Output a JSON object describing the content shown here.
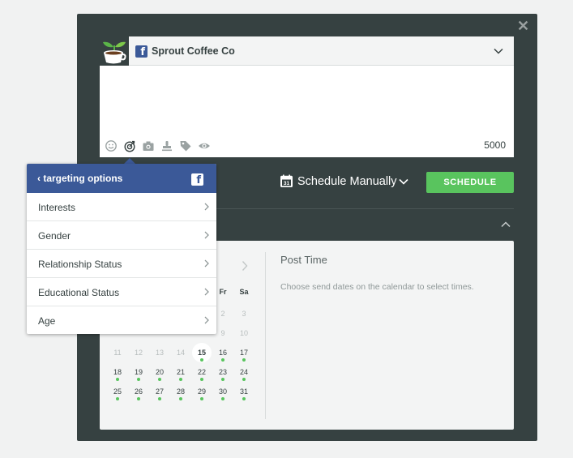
{
  "composer": {
    "profile_name": "Sprout Coffee Co",
    "char_count": "5000",
    "tools": [
      "emoji-icon",
      "target-icon",
      "camera-icon",
      "stamp-icon",
      "tag-icon",
      "preview-eye-icon"
    ]
  },
  "schedule": {
    "mode": "Schedule Manually",
    "button": "SCHEDULE"
  },
  "targeting": {
    "back_label": "‹ targeting options",
    "items": [
      {
        "label": "Interests"
      },
      {
        "label": "Gender"
      },
      {
        "label": "Relationship Status"
      },
      {
        "label": "Educational Status"
      },
      {
        "label": "Age"
      }
    ]
  },
  "calendar": {
    "weekday_headers": [
      "Fr",
      "Sa"
    ],
    "rows": [
      [
        "",
        "",
        "",
        "",
        "",
        "2",
        "3"
      ],
      [
        "",
        "",
        "",
        "",
        "",
        "9",
        "10"
      ],
      [
        "11",
        "12",
        "13",
        "14",
        "15",
        "16",
        "17"
      ],
      [
        "18",
        "19",
        "20",
        "21",
        "22",
        "23",
        "24"
      ],
      [
        "25",
        "26",
        "27",
        "28",
        "29",
        "30",
        "31"
      ]
    ],
    "today": "15"
  },
  "post_time": {
    "title": "Post Time",
    "hint": "Choose send dates on the calendar to select times."
  },
  "colors": {
    "modal": "#364141",
    "facebook": "#3b5998",
    "accent_green": "#59c45e"
  }
}
